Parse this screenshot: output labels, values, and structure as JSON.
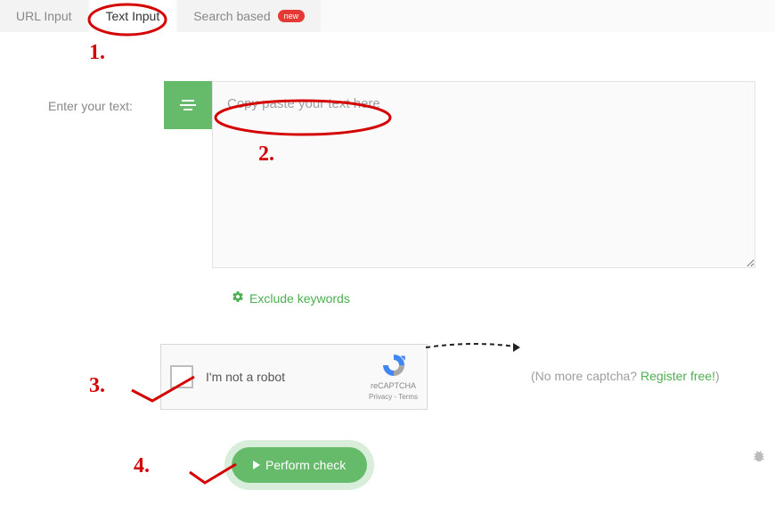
{
  "tabs": {
    "url": "URL Input",
    "text": "Text Input",
    "search": "Search based",
    "new_badge": "new"
  },
  "form": {
    "label": "Enter your text:",
    "placeholder": "Copy paste your text here",
    "exclude_label": "Exclude keywords"
  },
  "recaptcha": {
    "label": "I'm not a robot",
    "brand": "reCAPTCHA",
    "privacy": "Privacy",
    "terms": "Terms"
  },
  "aside": {
    "nomore_prefix": "(No more captcha? ",
    "register": "Register free!",
    "nomore_suffix": ")"
  },
  "button": {
    "perform": "Perform check"
  },
  "annotations": {
    "one": "1.",
    "two": "2.",
    "three": "3.",
    "four": "4."
  }
}
